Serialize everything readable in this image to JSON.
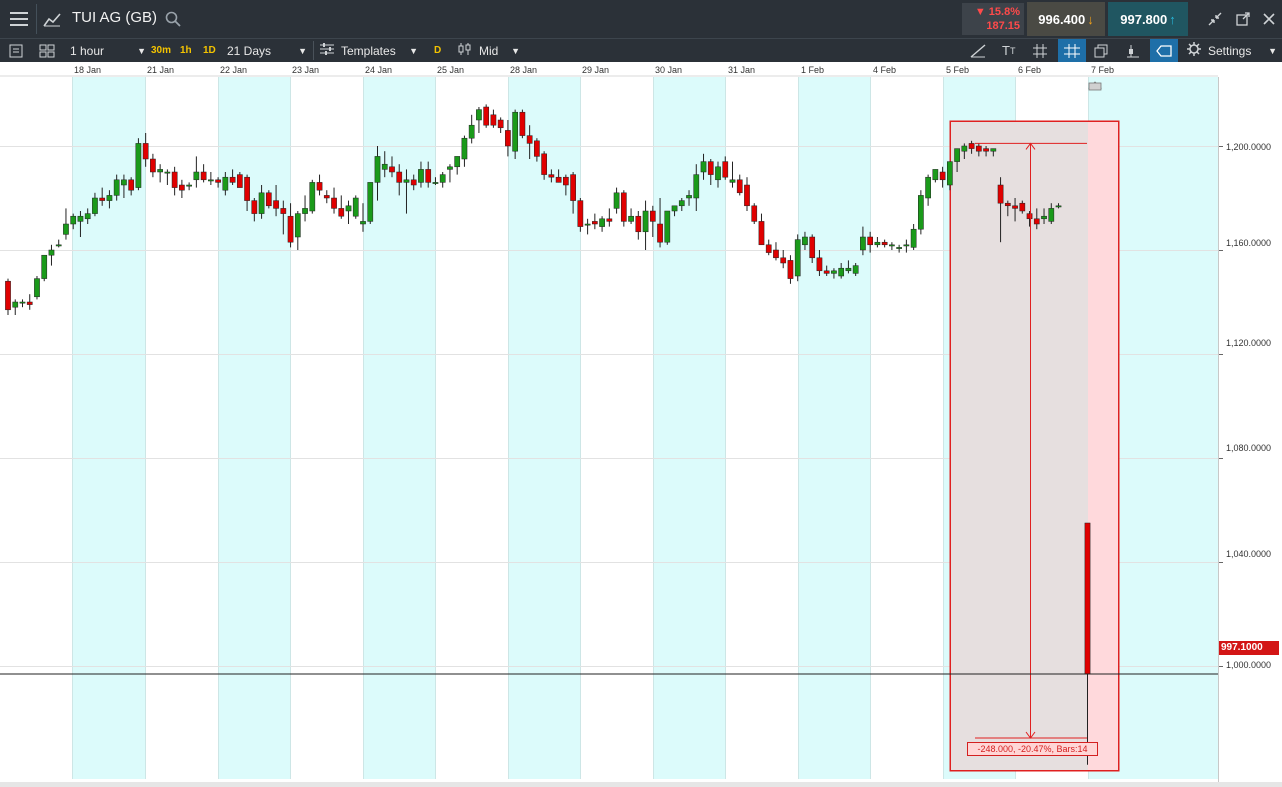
{
  "header": {
    "instrument": "TUI AG (GB)",
    "change_pct": "▼ 15.8%",
    "change_abs": "187.15",
    "sell_price": "996.400",
    "buy_price": "997.800",
    "colors": {
      "sell_bg": "#4a4a44",
      "buy_bg": "#205661",
      "down": "#ff4a4a"
    }
  },
  "toolbar": {
    "interval": "1 hour",
    "quick_intervals": [
      "30m",
      "1h",
      "1D"
    ],
    "range": "21 Days",
    "templates": "Templates",
    "price_mode_badge": "D",
    "price_mode": "Mid",
    "settings": "Settings"
  },
  "xaxis": [
    "18 Jan",
    "21 Jan",
    "22 Jan",
    "23 Jan",
    "24 Jan",
    "25 Jan",
    "28 Jan",
    "29 Jan",
    "30 Jan",
    "31 Jan",
    "1 Feb",
    "4 Feb",
    "5 Feb",
    "6 Feb",
    "7 Feb"
  ],
  "yaxis": [
    "1,200.0000",
    "1,160.0000",
    "1,120.0000",
    "1,080.0000",
    "1,040.0000",
    "1,000.0000"
  ],
  "current_price_label": "997.1000",
  "measure_label": "-248.000, -20.47%, Bars:14",
  "chart_data": {
    "type": "candlestick",
    "ylim": [
      962,
      1228
    ],
    "current_price": 997.1,
    "measure": {
      "from": 1201,
      "to": 962,
      "change": -248.0,
      "pct": -20.47,
      "bars": 14
    },
    "candles": [
      [
        1148,
        1149,
        1135,
        1137
      ],
      [
        1138,
        1141,
        1135,
        1140
      ],
      [
        1140,
        1141,
        1138,
        1140
      ],
      [
        1140,
        1143,
        1137,
        1139
      ],
      [
        1142,
        1150,
        1141,
        1149
      ],
      [
        1149,
        1158,
        1148,
        1158
      ],
      [
        1158,
        1162,
        1154,
        1160
      ],
      [
        1162,
        1164,
        1161,
        1162
      ],
      [
        1166,
        1176,
        1164,
        1170
      ],
      [
        1170,
        1174,
        1168,
        1173
      ],
      [
        1171,
        1175,
        1165,
        1173
      ],
      [
        1172,
        1176,
        1170,
        1174
      ],
      [
        1174,
        1182,
        1173,
        1180
      ],
      [
        1180,
        1184,
        1177,
        1179
      ],
      [
        1179,
        1183,
        1176,
        1181
      ],
      [
        1181,
        1189,
        1179,
        1187
      ],
      [
        1185,
        1189,
        1180,
        1187
      ],
      [
        1187,
        1188,
        1181,
        1183
      ],
      [
        1184,
        1203,
        1183,
        1201
      ],
      [
        1201,
        1205,
        1192,
        1195
      ],
      [
        1195,
        1197,
        1188,
        1190
      ],
      [
        1190,
        1193,
        1186,
        1191
      ],
      [
        1190,
        1191,
        1185,
        1190
      ],
      [
        1190,
        1192,
        1181,
        1184
      ],
      [
        1185,
        1187,
        1180,
        1183
      ],
      [
        1185,
        1186,
        1183,
        1185
      ],
      [
        1187,
        1196,
        1184,
        1190
      ],
      [
        1190,
        1193,
        1186,
        1187
      ],
      [
        1187,
        1190,
        1185,
        1187
      ],
      [
        1187,
        1188,
        1184,
        1186
      ],
      [
        1183,
        1190,
        1181,
        1188
      ],
      [
        1188,
        1191,
        1185,
        1186
      ],
      [
        1189,
        1190,
        1184,
        1184
      ],
      [
        1188,
        1189,
        1175,
        1179
      ],
      [
        1179,
        1180,
        1171,
        1174
      ],
      [
        1174,
        1185,
        1172,
        1182
      ],
      [
        1182,
        1183,
        1176,
        1177
      ],
      [
        1179,
        1185,
        1173,
        1176
      ],
      [
        1176,
        1179,
        1166,
        1174
      ],
      [
        1173,
        1178,
        1161,
        1163
      ],
      [
        1165,
        1175,
        1160,
        1174
      ],
      [
        1174,
        1181,
        1171,
        1176
      ],
      [
        1175,
        1187,
        1174,
        1186
      ],
      [
        1186,
        1189,
        1181,
        1183
      ],
      [
        1181,
        1183,
        1178,
        1180
      ],
      [
        1180,
        1184,
        1174,
        1176
      ],
      [
        1176,
        1181,
        1172,
        1173
      ],
      [
        1175,
        1179,
        1170,
        1177
      ],
      [
        1173,
        1181,
        1172,
        1180
      ],
      [
        1170,
        1178,
        1167,
        1171
      ],
      [
        1171,
        1186,
        1170,
        1186
      ],
      [
        1186,
        1200,
        1179,
        1196
      ],
      [
        1191,
        1198,
        1188,
        1193
      ],
      [
        1192,
        1196,
        1188,
        1190
      ],
      [
        1190,
        1193,
        1181,
        1186
      ],
      [
        1186,
        1191,
        1174,
        1187
      ],
      [
        1187,
        1189,
        1183,
        1185
      ],
      [
        1186,
        1194,
        1184,
        1191
      ],
      [
        1191,
        1194,
        1184,
        1186
      ],
      [
        1186,
        1188,
        1185,
        1186
      ],
      [
        1186,
        1190,
        1184,
        1189
      ],
      [
        1191,
        1193,
        1186,
        1192
      ],
      [
        1192,
        1196,
        1189,
        1196
      ],
      [
        1195,
        1204,
        1192,
        1203
      ],
      [
        1203,
        1212,
        1201,
        1208
      ],
      [
        1210,
        1215,
        1205,
        1214
      ],
      [
        1215,
        1216,
        1207,
        1208
      ],
      [
        1212,
        1214,
        1207,
        1208
      ],
      [
        1210,
        1211,
        1205,
        1207
      ],
      [
        1206,
        1210,
        1196,
        1200
      ],
      [
        1198,
        1214,
        1195,
        1213
      ],
      [
        1213,
        1214,
        1203,
        1204
      ],
      [
        1204,
        1208,
        1195,
        1201
      ],
      [
        1202,
        1203,
        1194,
        1196
      ],
      [
        1197,
        1198,
        1187,
        1189
      ],
      [
        1189,
        1191,
        1186,
        1188
      ],
      [
        1188,
        1191,
        1186,
        1186
      ],
      [
        1188,
        1189,
        1181,
        1185
      ],
      [
        1189,
        1190,
        1174,
        1179
      ],
      [
        1179,
        1180,
        1167,
        1169
      ],
      [
        1170,
        1172,
        1166,
        1170
      ],
      [
        1171,
        1174,
        1168,
        1170
      ],
      [
        1169,
        1173,
        1167,
        1172
      ],
      [
        1172,
        1176,
        1169,
        1171
      ],
      [
        1176,
        1184,
        1174,
        1182
      ],
      [
        1182,
        1183,
        1169,
        1171
      ],
      [
        1171,
        1176,
        1170,
        1173
      ],
      [
        1173,
        1175,
        1164,
        1167
      ],
      [
        1167,
        1179,
        1160,
        1175
      ],
      [
        1175,
        1177,
        1165,
        1171
      ],
      [
        1170,
        1180,
        1161,
        1163
      ],
      [
        1163,
        1175,
        1162,
        1175
      ],
      [
        1175,
        1177,
        1173,
        1177
      ],
      [
        1177,
        1180,
        1175,
        1179
      ],
      [
        1180,
        1183,
        1177,
        1181
      ],
      [
        1180,
        1193,
        1175,
        1189
      ],
      [
        1190,
        1197,
        1187,
        1194
      ],
      [
        1194,
        1195,
        1185,
        1189
      ],
      [
        1187,
        1194,
        1184,
        1192
      ],
      [
        1194,
        1196,
        1187,
        1188
      ],
      [
        1186,
        1194,
        1184,
        1187
      ],
      [
        1187,
        1189,
        1181,
        1182
      ],
      [
        1185,
        1188,
        1175,
        1177
      ],
      [
        1177,
        1178,
        1170,
        1171
      ],
      [
        1171,
        1174,
        1162,
        1162
      ],
      [
        1162,
        1164,
        1158,
        1159
      ],
      [
        1160,
        1163,
        1156,
        1157
      ],
      [
        1157,
        1160,
        1153,
        1155
      ],
      [
        1156,
        1158,
        1147,
        1149
      ],
      [
        1150,
        1166,
        1148,
        1164
      ],
      [
        1162,
        1167,
        1160,
        1165
      ],
      [
        1165,
        1166,
        1155,
        1157
      ],
      [
        1157,
        1160,
        1150,
        1152
      ],
      [
        1152,
        1154,
        1150,
        1151
      ],
      [
        1151,
        1153,
        1149,
        1152
      ],
      [
        1150,
        1155,
        1149,
        1153
      ],
      [
        1152,
        1156,
        1151,
        1153
      ],
      [
        1151,
        1155,
        1150,
        1154
      ],
      [
        1160,
        1169,
        1158,
        1165
      ],
      [
        1165,
        1167,
        1159,
        1162
      ],
      [
        1162,
        1165,
        1161,
        1163
      ],
      [
        1163,
        1164,
        1161,
        1162
      ],
      [
        1162,
        1163,
        1160,
        1162
      ],
      [
        1161,
        1162,
        1159,
        1161
      ],
      [
        1162,
        1164,
        1159,
        1162
      ],
      [
        1161,
        1170,
        1160,
        1168
      ],
      [
        1168,
        1183,
        1166,
        1181
      ],
      [
        1180,
        1189,
        1177,
        1188
      ],
      [
        1187,
        1191,
        1186,
        1191
      ],
      [
        1190,
        1192,
        1184,
        1187
      ],
      [
        1185,
        1194,
        1183,
        1194
      ],
      [
        1194,
        1199,
        1190,
        1199
      ],
      [
        1198,
        1201,
        1195,
        1200
      ],
      [
        1201,
        1202,
        1197,
        1199
      ],
      [
        1200,
        1201,
        1196,
        1198
      ],
      [
        1199,
        1200,
        1196,
        1198
      ],
      [
        1198,
        1199,
        1196,
        1199
      ],
      [
        1185,
        1188,
        1163,
        1178
      ],
      [
        1178,
        1179,
        1173,
        1177
      ],
      [
        1177,
        1180,
        1171,
        1176
      ],
      [
        1178,
        1179,
        1174,
        1175
      ],
      [
        1174,
        1175,
        1169,
        1172
      ],
      [
        1172,
        1176,
        1168,
        1170
      ],
      [
        1172,
        1176,
        1170,
        1173
      ],
      [
        1171,
        1178,
        1170,
        1176
      ],
      [
        1177,
        1178,
        1176,
        1177
      ],
      [
        1055,
        1055,
        962,
        997
      ]
    ]
  }
}
